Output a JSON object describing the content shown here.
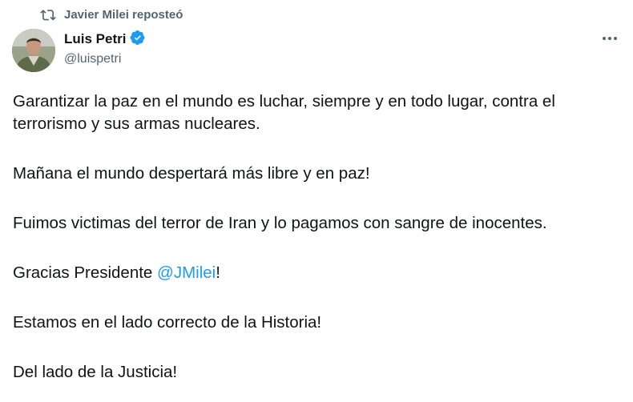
{
  "repost": {
    "icon": "repost-icon",
    "label": "Javier Milei reposteó"
  },
  "author": {
    "avatar": "avatar",
    "name": "Luis Petri",
    "verified_icon": "verified-badge-icon",
    "handle": "@luispetri"
  },
  "menu": {
    "icon": "more-options-icon"
  },
  "tweet": {
    "p1": "Garantizar la paz en el mundo es luchar, siempre y en todo lugar, contra el terrorismo y sus armas nucleares.",
    "p2": "Mañana el mundo despertará más libre y en paz!",
    "p3": "Fuimos victimas del terror de Iran y lo pagamos con sangre de inocentes.",
    "p4_before": "Gracias Presidente ",
    "p4_mention": "@JMilei",
    "p4_after": "!",
    "p5": "Estamos en el lado correcto de la Historia!",
    "p6": "Del lado de la Justicia!"
  },
  "colors": {
    "text": "#0f1419",
    "muted": "#536471",
    "link": "#1d9bf0",
    "verified": "#1d9bf0"
  }
}
